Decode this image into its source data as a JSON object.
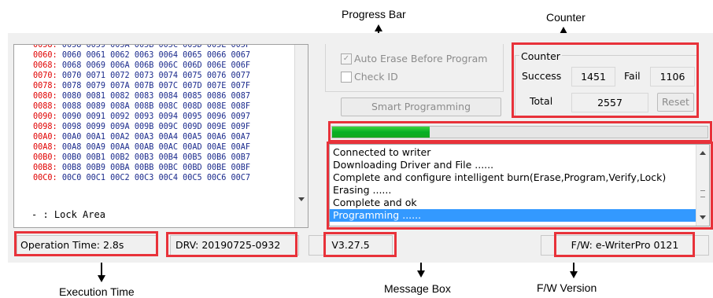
{
  "annotations": {
    "progress_bar": "Progress Bar",
    "counter": "Counter",
    "execution_time": "Execution Time",
    "message_box": "Message Box",
    "fw_version": "F/W Version"
  },
  "hex_rows": [
    {
      "addr": "0060:",
      "vals": "0060 0061 0062 0063 0064 0065 0066 0067"
    },
    {
      "addr": "0068:",
      "vals": "0068 0069 006A 006B 006C 006D 006E 006F"
    },
    {
      "addr": "0070:",
      "vals": "0070 0071 0072 0073 0074 0075 0076 0077"
    },
    {
      "addr": "0078:",
      "vals": "0078 0079 007A 007B 007C 007D 007E 007F"
    },
    {
      "addr": "0080:",
      "vals": "0080 0081 0082 0083 0084 0085 0086 0087"
    },
    {
      "addr": "0088:",
      "vals": "0088 0089 008A 008B 008C 008D 008E 008F"
    },
    {
      "addr": "0090:",
      "vals": "0090 0091 0092 0093 0094 0095 0096 0097"
    },
    {
      "addr": "0098:",
      "vals": "0098 0099 009A 009B 009C 009D 009E 009F"
    },
    {
      "addr": "00A0:",
      "vals": "00A0 00A1 00A2 00A3 00A4 00A5 00A6 00A7"
    },
    {
      "addr": "00A8:",
      "vals": "00A8 00A9 00AA 00AB 00AC 00AD 00AE 00AF"
    },
    {
      "addr": "00B0:",
      "vals": "00B0 00B1 00B2 00B3 00B4 00B5 00B6 00B7"
    },
    {
      "addr": "00B8:",
      "vals": "00B8 00B9 00BA 00BB 00BC 00BD 00BE 00BF"
    },
    {
      "addr": "00C0:",
      "vals": "00C0 00C1 00C2 00C3 00C4 00C5 00C6 00C7"
    }
  ],
  "lock_area_label": "- : Lock Area",
  "options": {
    "auto_erase_label": "Auto Erase Before Program",
    "auto_erase_checked": true,
    "check_id_label": "Check ID",
    "check_id_checked": false
  },
  "smart_programming_label": "Smart Programming",
  "counter": {
    "title": "Counter",
    "success_label": "Success",
    "success_value": "1451",
    "fail_label": "Fail",
    "fail_value": "1106",
    "total_label": "Total",
    "total_value": "2557",
    "reset_label": "Reset"
  },
  "progress": {
    "fraction": 0.26
  },
  "messages": [
    "Connected to writer",
    "Downloading Driver and File ......",
    "Complete and configure intelligent burn(Erase,Program,Verify,Lock)",
    "Erasing ......",
    "Complete and ok",
    "Programming ......"
  ],
  "selected_message_index": 5,
  "status_bar": {
    "operation_time": "Operation Time: 2.8s",
    "driver_version": "DRV: 20190725-0932",
    "app_version": "V3.27.5",
    "firmware": "F/W: e-WriterPro 0121"
  },
  "colors": {
    "highlight": "#e8323a",
    "progress_green": "#06b025",
    "selection_blue": "#3399ff",
    "address_red": "#e00000"
  }
}
